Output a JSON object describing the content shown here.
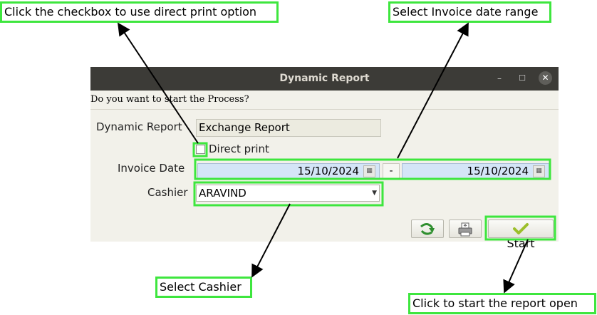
{
  "window": {
    "title": "Dynamic Report",
    "prompt": "Do you want to start the Process?"
  },
  "form": {
    "report_label": "Dynamic Report",
    "report_value": "Exchange Report",
    "direct_print_label": "Direct print",
    "direct_print_checked": false,
    "invoice_date_label": "Invoice Date",
    "date_from": "15/10/2024",
    "date_separator": "-",
    "date_to": "15/10/2024",
    "cashier_label": "Cashier",
    "cashier_value": "ARAVIND"
  },
  "buttons": {
    "refresh_icon": "refresh-arrow-icon",
    "print_icon": "printer-icon",
    "start_label": "Start",
    "start_icon": "checkmark-icon"
  },
  "callouts": {
    "direct_print": "Click the checkbox to use direct print option",
    "invoice_date": "Select Invoice date range",
    "cashier": "Select Cashier",
    "start": "Click to start the report open"
  },
  "colors": {
    "highlight": "#3ee63e",
    "titlebar": "#3c3b37",
    "window_bg": "#f2f1ea",
    "date_bg": "#d4e5f7"
  }
}
